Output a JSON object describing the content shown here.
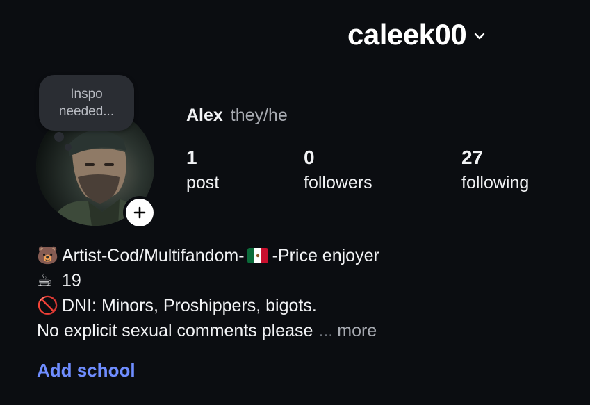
{
  "header": {
    "username": "caleek00",
    "dropdown_icon": "chevron-down-icon"
  },
  "note": {
    "line1": "Inspo",
    "line2": "needed..."
  },
  "profile": {
    "display_name": "Alex",
    "pronouns": "they/he"
  },
  "stats": [
    {
      "value": "1",
      "label": "post"
    },
    {
      "value": "0",
      "label": "followers"
    },
    {
      "value": "27",
      "label": "following"
    }
  ],
  "bio": {
    "line1_emoji": "🐻",
    "line1_pre": "Artist-Cod/Multifandom-",
    "line1_flag": "mexico-flag-icon",
    "line1_post": "-Price enjoyer",
    "line2_emoji": "☕",
    "line2_text": "19",
    "line3_emoji": "🚫",
    "line3_text": "DNI: Minors, Proshippers, bigots.",
    "line4_text": "No explicit sexual comments please",
    "ellipsis": "...",
    "more": "more"
  },
  "add_school": "Add school",
  "colors": {
    "background": "#0b0d11",
    "link": "#6f8dff",
    "note_bubble": "#2a2d33"
  }
}
